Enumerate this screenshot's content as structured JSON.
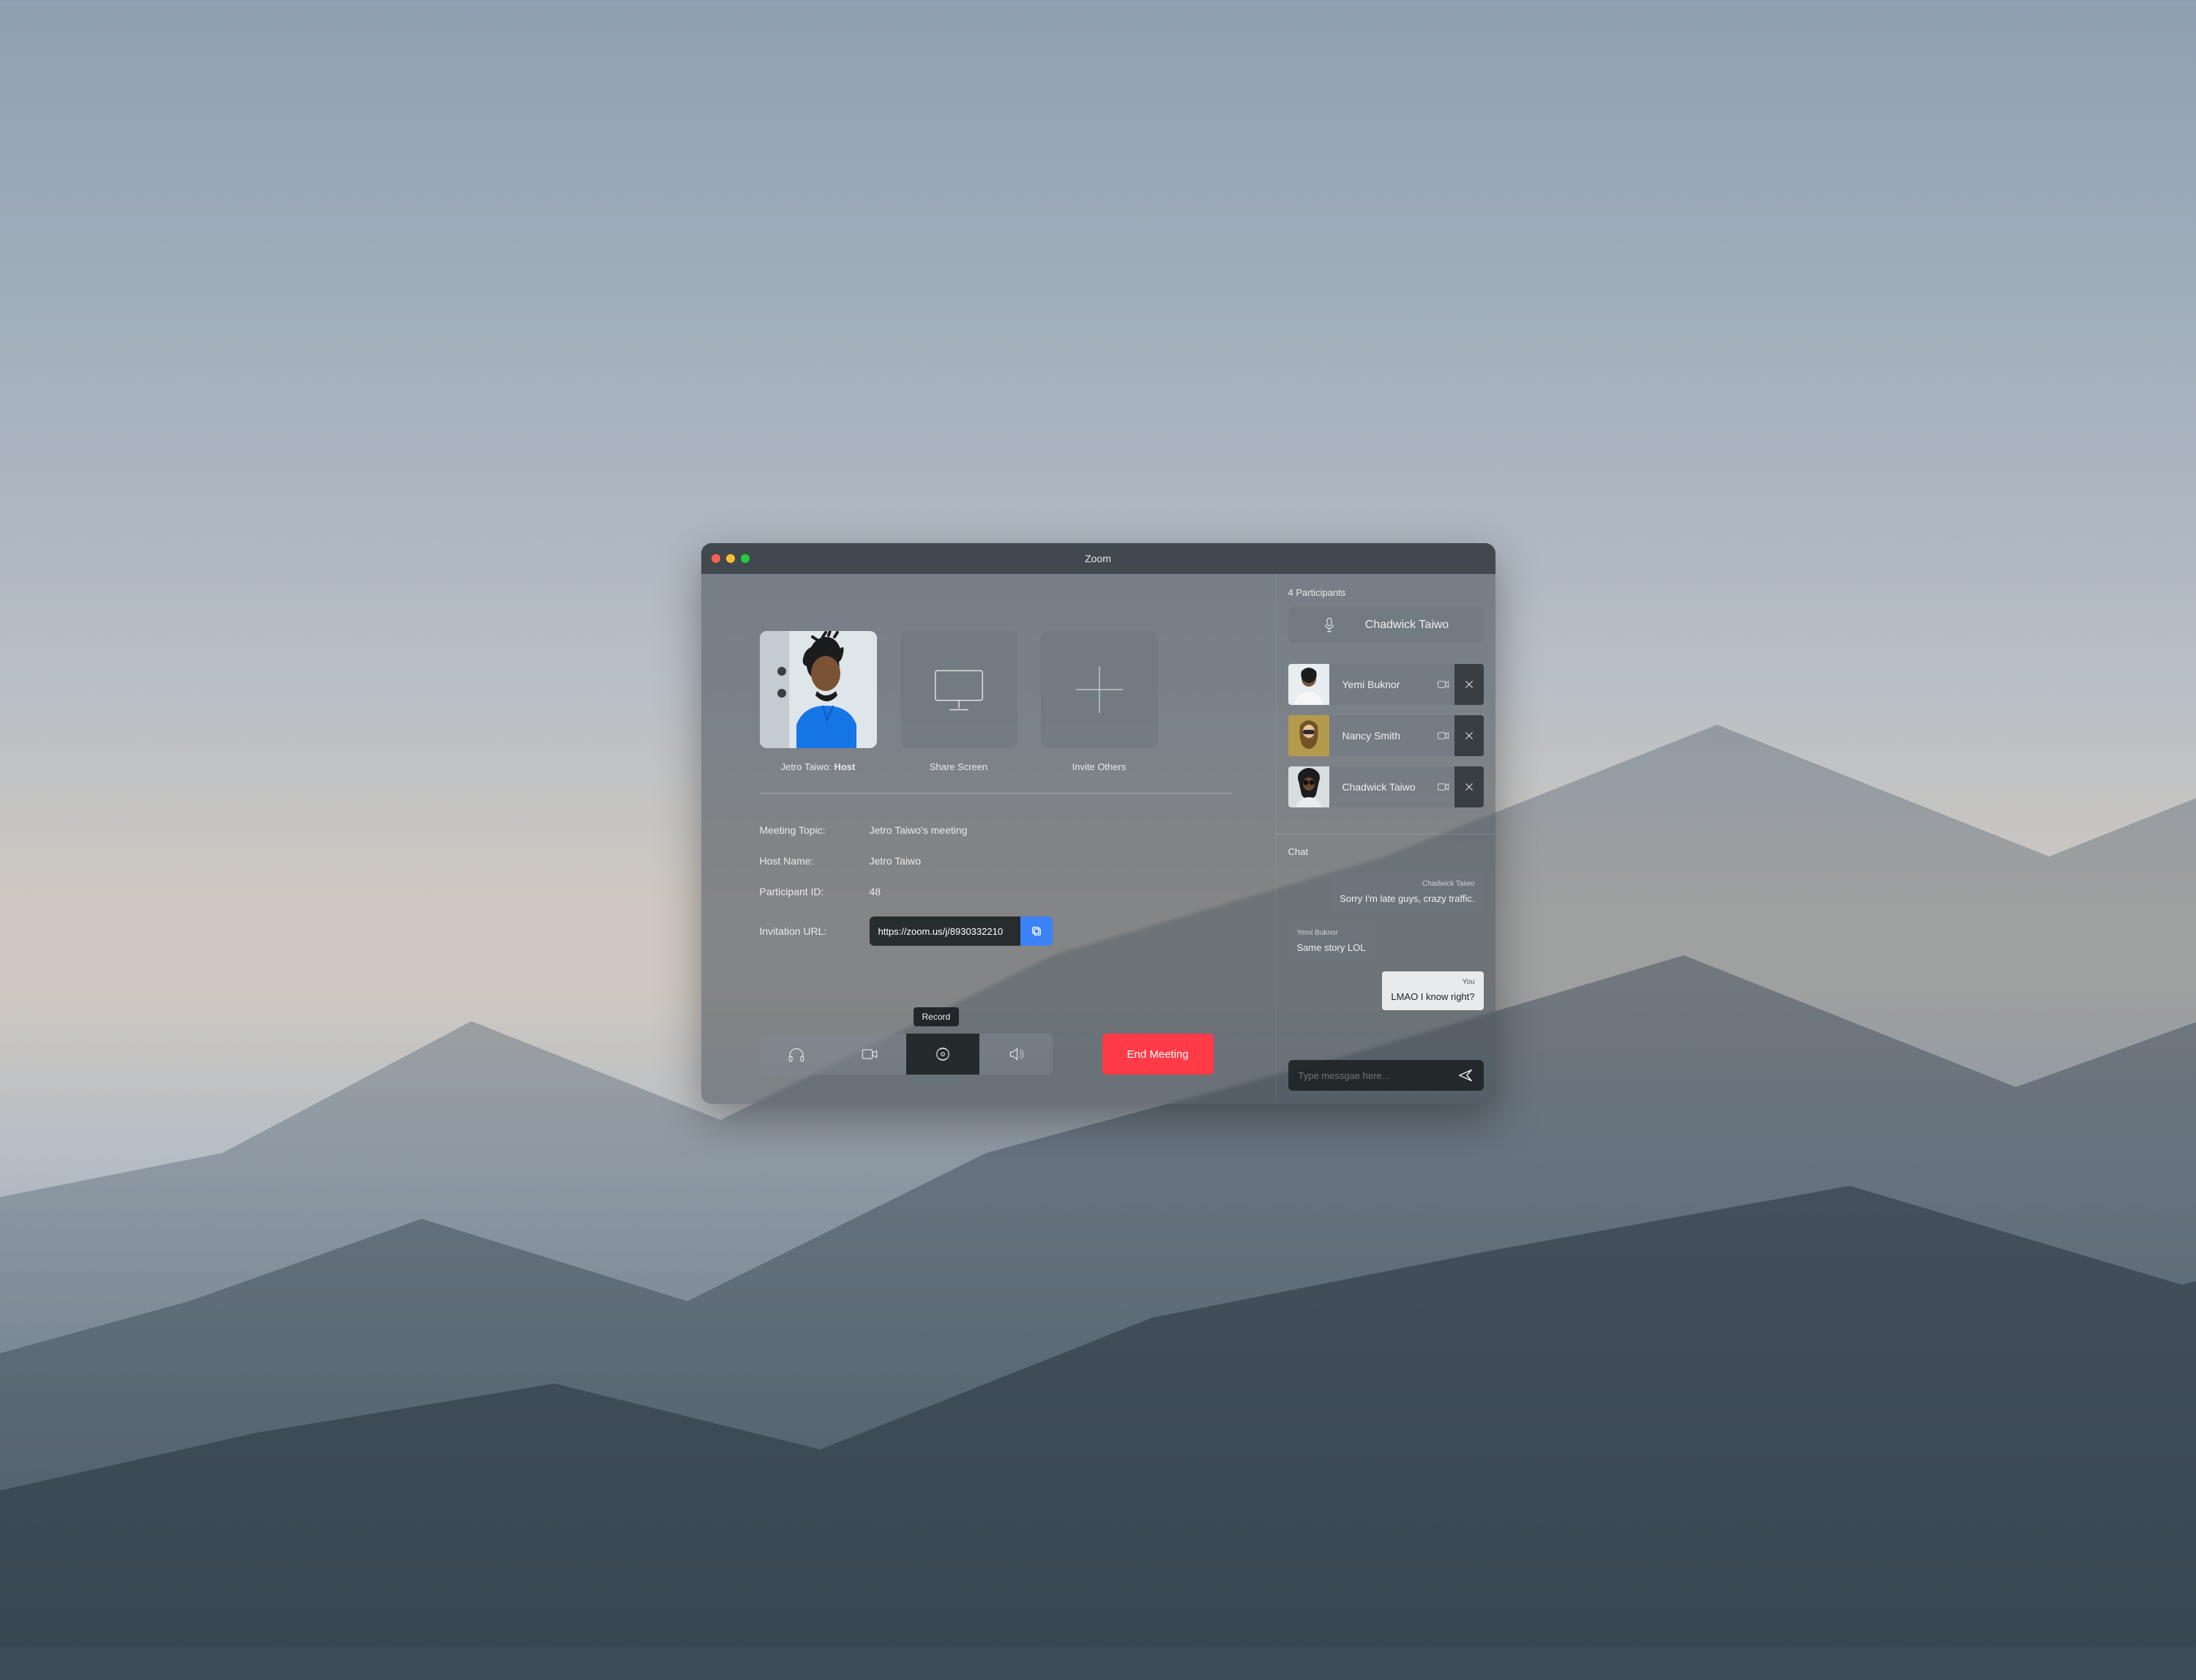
{
  "window": {
    "title": "Zoom"
  },
  "tiles": {
    "user": {
      "name": "Jetro Taiwo:",
      "role": "Host"
    },
    "share": {
      "label": "Share Screen"
    },
    "invite": {
      "label": "Invite Others"
    }
  },
  "info": {
    "topic_label": "Meeting Topic:",
    "topic_value": "Jetro Taiwo's meeting",
    "host_label": "Host Name:",
    "host_value": "Jetro Taiwo",
    "pid_label": "Participant ID:",
    "pid_value": "48",
    "url_label": "Invitation URL:",
    "url_value": "https://zoom.us/j/8930332210"
  },
  "toolbar": {
    "tooltip": "Record",
    "end_label": "End Meeting"
  },
  "panel": {
    "count_label": "4 Participants",
    "speaking": "Chadwick Taiwo",
    "participants": [
      {
        "name": "Yemi Buknor"
      },
      {
        "name": "Nancy Smith"
      },
      {
        "name": "Chadwick Taiwo"
      }
    ],
    "chat_title": "Chat",
    "messages": [
      {
        "who": "Chadwick Taiwo",
        "text": "Sorry I'm late guys, crazy traffic.",
        "side": "other-right"
      },
      {
        "who": "Yemi Buknor",
        "text": "Same story LOL",
        "side": "other-left"
      },
      {
        "who": "You",
        "text": "LMAO I know right?",
        "side": "me"
      }
    ],
    "input_placeholder": "Type messgae here..."
  }
}
